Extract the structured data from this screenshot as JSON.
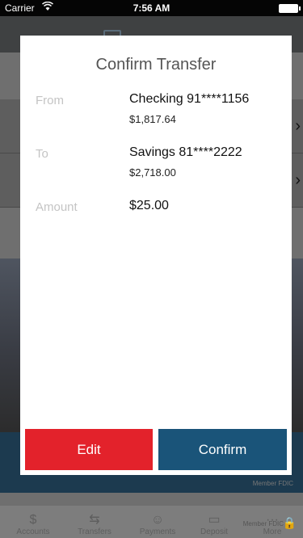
{
  "status_bar": {
    "carrier": "Carrier",
    "time": "7:56 AM"
  },
  "background": {
    "tabs": [
      {
        "label": "Accounts",
        "icon": "dollar-icon"
      },
      {
        "label": "Transfers",
        "icon": "transfer-icon"
      },
      {
        "label": "Payments",
        "icon": "payments-icon"
      },
      {
        "label": "Deposit",
        "icon": "deposit-icon"
      },
      {
        "label": "More",
        "icon": "more-icon"
      }
    ],
    "fdic_text": "Member FDIC"
  },
  "modal": {
    "title": "Confirm Transfer",
    "from": {
      "label": "From",
      "account": "Checking 91****1156",
      "balance": "$1,817.64"
    },
    "to": {
      "label": "To",
      "account": "Savings 81****2222",
      "balance": "$2,718.00"
    },
    "amount": {
      "label": "Amount",
      "value": "$25.00"
    },
    "edit_label": "Edit",
    "confirm_label": "Confirm"
  }
}
